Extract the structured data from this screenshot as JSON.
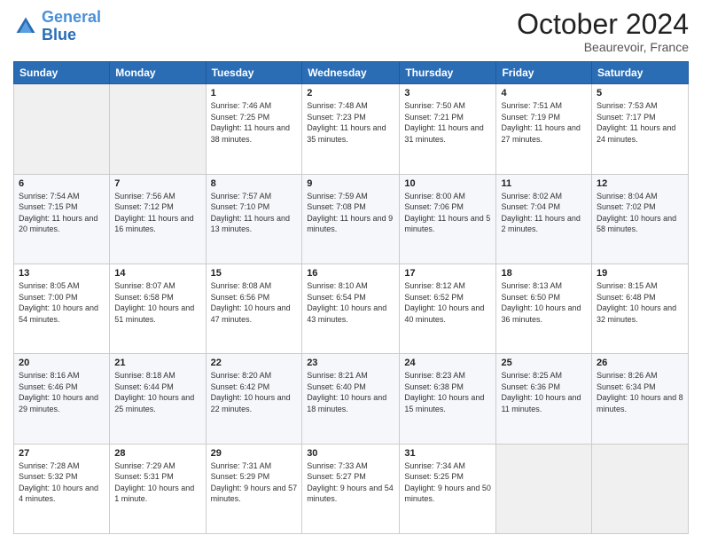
{
  "header": {
    "logo_text_general": "General",
    "logo_text_blue": "Blue",
    "month": "October 2024",
    "location": "Beaurevoir, France"
  },
  "days_of_week": [
    "Sunday",
    "Monday",
    "Tuesday",
    "Wednesday",
    "Thursday",
    "Friday",
    "Saturday"
  ],
  "weeks": [
    [
      {
        "day": "",
        "info": ""
      },
      {
        "day": "",
        "info": ""
      },
      {
        "day": "1",
        "info": "Sunrise: 7:46 AM\nSunset: 7:25 PM\nDaylight: 11 hours and 38 minutes."
      },
      {
        "day": "2",
        "info": "Sunrise: 7:48 AM\nSunset: 7:23 PM\nDaylight: 11 hours and 35 minutes."
      },
      {
        "day": "3",
        "info": "Sunrise: 7:50 AM\nSunset: 7:21 PM\nDaylight: 11 hours and 31 minutes."
      },
      {
        "day": "4",
        "info": "Sunrise: 7:51 AM\nSunset: 7:19 PM\nDaylight: 11 hours and 27 minutes."
      },
      {
        "day": "5",
        "info": "Sunrise: 7:53 AM\nSunset: 7:17 PM\nDaylight: 11 hours and 24 minutes."
      }
    ],
    [
      {
        "day": "6",
        "info": "Sunrise: 7:54 AM\nSunset: 7:15 PM\nDaylight: 11 hours and 20 minutes."
      },
      {
        "day": "7",
        "info": "Sunrise: 7:56 AM\nSunset: 7:12 PM\nDaylight: 11 hours and 16 minutes."
      },
      {
        "day": "8",
        "info": "Sunrise: 7:57 AM\nSunset: 7:10 PM\nDaylight: 11 hours and 13 minutes."
      },
      {
        "day": "9",
        "info": "Sunrise: 7:59 AM\nSunset: 7:08 PM\nDaylight: 11 hours and 9 minutes."
      },
      {
        "day": "10",
        "info": "Sunrise: 8:00 AM\nSunset: 7:06 PM\nDaylight: 11 hours and 5 minutes."
      },
      {
        "day": "11",
        "info": "Sunrise: 8:02 AM\nSunset: 7:04 PM\nDaylight: 11 hours and 2 minutes."
      },
      {
        "day": "12",
        "info": "Sunrise: 8:04 AM\nSunset: 7:02 PM\nDaylight: 10 hours and 58 minutes."
      }
    ],
    [
      {
        "day": "13",
        "info": "Sunrise: 8:05 AM\nSunset: 7:00 PM\nDaylight: 10 hours and 54 minutes."
      },
      {
        "day": "14",
        "info": "Sunrise: 8:07 AM\nSunset: 6:58 PM\nDaylight: 10 hours and 51 minutes."
      },
      {
        "day": "15",
        "info": "Sunrise: 8:08 AM\nSunset: 6:56 PM\nDaylight: 10 hours and 47 minutes."
      },
      {
        "day": "16",
        "info": "Sunrise: 8:10 AM\nSunset: 6:54 PM\nDaylight: 10 hours and 43 minutes."
      },
      {
        "day": "17",
        "info": "Sunrise: 8:12 AM\nSunset: 6:52 PM\nDaylight: 10 hours and 40 minutes."
      },
      {
        "day": "18",
        "info": "Sunrise: 8:13 AM\nSunset: 6:50 PM\nDaylight: 10 hours and 36 minutes."
      },
      {
        "day": "19",
        "info": "Sunrise: 8:15 AM\nSunset: 6:48 PM\nDaylight: 10 hours and 32 minutes."
      }
    ],
    [
      {
        "day": "20",
        "info": "Sunrise: 8:16 AM\nSunset: 6:46 PM\nDaylight: 10 hours and 29 minutes."
      },
      {
        "day": "21",
        "info": "Sunrise: 8:18 AM\nSunset: 6:44 PM\nDaylight: 10 hours and 25 minutes."
      },
      {
        "day": "22",
        "info": "Sunrise: 8:20 AM\nSunset: 6:42 PM\nDaylight: 10 hours and 22 minutes."
      },
      {
        "day": "23",
        "info": "Sunrise: 8:21 AM\nSunset: 6:40 PM\nDaylight: 10 hours and 18 minutes."
      },
      {
        "day": "24",
        "info": "Sunrise: 8:23 AM\nSunset: 6:38 PM\nDaylight: 10 hours and 15 minutes."
      },
      {
        "day": "25",
        "info": "Sunrise: 8:25 AM\nSunset: 6:36 PM\nDaylight: 10 hours and 11 minutes."
      },
      {
        "day": "26",
        "info": "Sunrise: 8:26 AM\nSunset: 6:34 PM\nDaylight: 10 hours and 8 minutes."
      }
    ],
    [
      {
        "day": "27",
        "info": "Sunrise: 7:28 AM\nSunset: 5:32 PM\nDaylight: 10 hours and 4 minutes."
      },
      {
        "day": "28",
        "info": "Sunrise: 7:29 AM\nSunset: 5:31 PM\nDaylight: 10 hours and 1 minute."
      },
      {
        "day": "29",
        "info": "Sunrise: 7:31 AM\nSunset: 5:29 PM\nDaylight: 9 hours and 57 minutes."
      },
      {
        "day": "30",
        "info": "Sunrise: 7:33 AM\nSunset: 5:27 PM\nDaylight: 9 hours and 54 minutes."
      },
      {
        "day": "31",
        "info": "Sunrise: 7:34 AM\nSunset: 5:25 PM\nDaylight: 9 hours and 50 minutes."
      },
      {
        "day": "",
        "info": ""
      },
      {
        "day": "",
        "info": ""
      }
    ]
  ]
}
